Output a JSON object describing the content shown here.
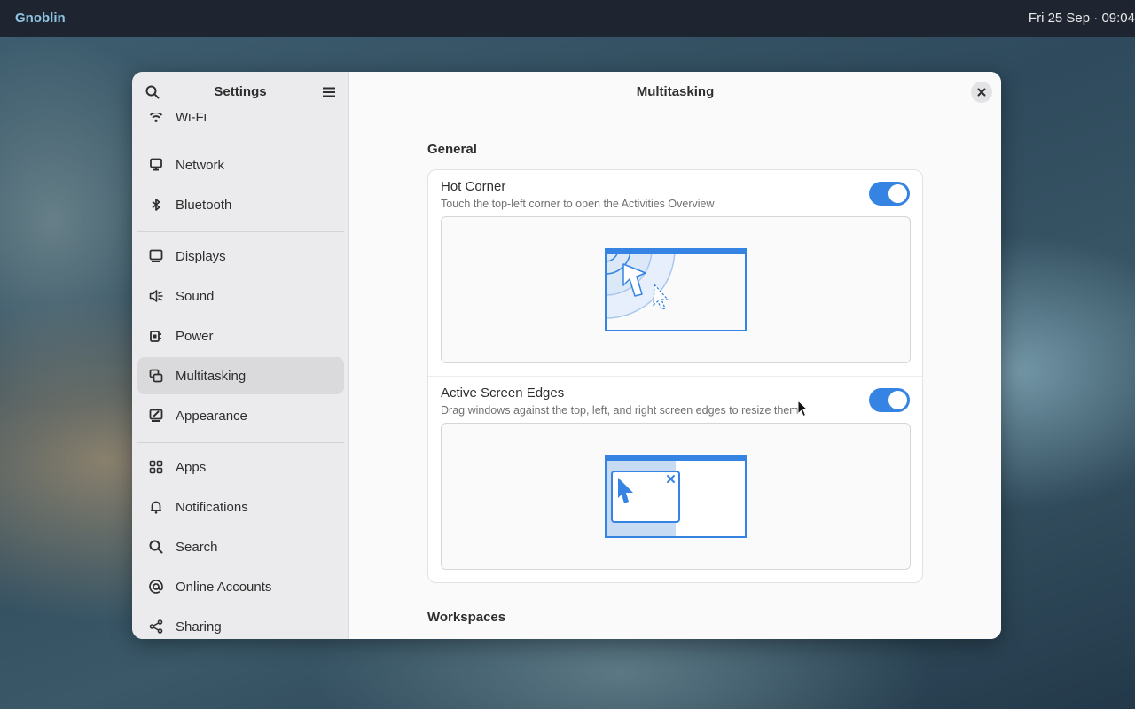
{
  "topbar": {
    "app_name": "Gnoblin",
    "datetime": "Fri 25 Sep  ·  09:04"
  },
  "sidebar": {
    "title": "Settings",
    "items": [
      {
        "label": "Wi-Fi",
        "icon": "wifi-icon"
      },
      {
        "label": "Network",
        "icon": "network-icon"
      },
      {
        "label": "Bluetooth",
        "icon": "bluetooth-icon"
      },
      {
        "label": "Displays",
        "icon": "display-icon"
      },
      {
        "label": "Sound",
        "icon": "speaker-icon"
      },
      {
        "label": "Power",
        "icon": "power-plug-icon"
      },
      {
        "label": "Multitasking",
        "icon": "multitasking-icon",
        "selected": true
      },
      {
        "label": "Appearance",
        "icon": "appearance-icon"
      },
      {
        "label": "Apps",
        "icon": "apps-grid-icon"
      },
      {
        "label": "Notifications",
        "icon": "bell-icon"
      },
      {
        "label": "Search",
        "icon": "search-icon"
      },
      {
        "label": "Online Accounts",
        "icon": "at-sign-icon"
      },
      {
        "label": "Sharing",
        "icon": "share-icon"
      }
    ]
  },
  "main": {
    "title": "Multitasking",
    "general_heading": "General",
    "hot_corner": {
      "title": "Hot Corner",
      "subtitle": "Touch the top-left corner to open the Activities Overview",
      "enabled": true
    },
    "active_edges": {
      "title": "Active Screen Edges",
      "subtitle": "Drag windows against the top, left, and right screen edges to resize them",
      "enabled": true
    },
    "workspaces_heading": "Workspaces"
  },
  "colors": {
    "accent": "#3584e4",
    "topbar": "#1e2531",
    "sidebar": "#ebebed",
    "selected_row": "#dadadc"
  }
}
